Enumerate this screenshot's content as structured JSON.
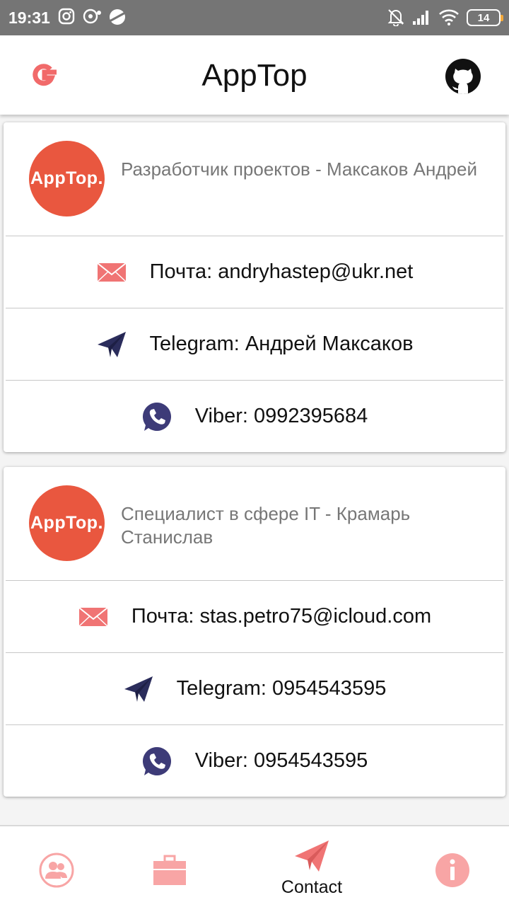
{
  "status_bar": {
    "time": "19:31",
    "battery": "14"
  },
  "app_bar": {
    "title": "AppTop",
    "left_icon": "google-icon",
    "right_icon": "github-icon"
  },
  "cards": [
    {
      "avatar_text": "AppTop.",
      "name": "Разработчик проектов - Максаков Андрей",
      "email": "Почта: andryhastep@ukr.net",
      "telegram": "Telegram: Андрей Максаков",
      "viber": "Viber: 0992395684"
    },
    {
      "avatar_text": "AppTop.",
      "name": "Специалист в сфере IT - Крамарь Станислав",
      "email": "Почта: stas.petro75@icloud.com",
      "telegram": "Telegram: 0954543595",
      "viber": "Viber: 0954543595"
    }
  ],
  "bottom_nav": {
    "items": [
      {
        "icon": "users-icon",
        "label": ""
      },
      {
        "icon": "briefcase-icon",
        "label": ""
      },
      {
        "icon": "paper-plane-icon",
        "label": "Contact"
      },
      {
        "icon": "info-icon",
        "label": ""
      }
    ],
    "active_index": 2
  },
  "colors": {
    "accent": "#f07474",
    "avatar_bg": "#e9573f",
    "google_red": "#f16a6a",
    "telegram_navy": "#2b2d5c",
    "viber_indigo": "#3d3b78"
  }
}
